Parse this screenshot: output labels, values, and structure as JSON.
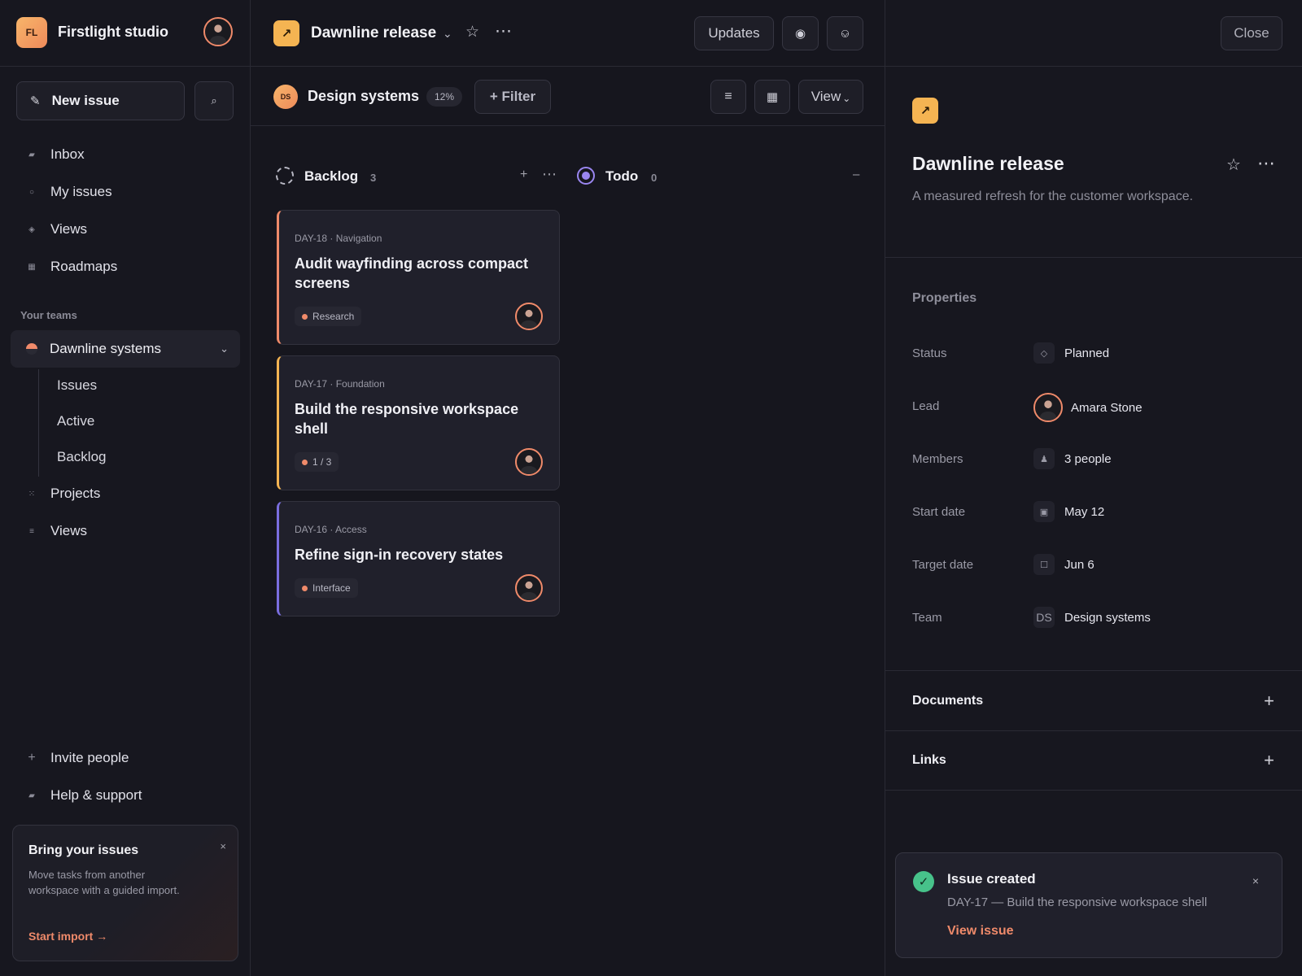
{
  "workspace": {
    "logo": "FL",
    "name": "Firstlight studio"
  },
  "sidebar": {
    "new_issue": "New issue",
    "search_icon": "⌕",
    "nav": [
      {
        "label": "Inbox",
        "icon": "▰"
      },
      {
        "label": "My issues",
        "icon": "○"
      },
      {
        "label": "Views",
        "icon": "◈"
      },
      {
        "label": "Roadmaps",
        "icon": "▦"
      }
    ],
    "teams_label": "Your teams",
    "team": {
      "name": "Dawnline systems",
      "chevron": "⌄"
    },
    "team_items": [
      "Issues",
      "Active",
      "Backlog"
    ],
    "nav2": [
      {
        "label": "Projects",
        "icon": "⁙"
      },
      {
        "label": "Views",
        "icon": "≡"
      }
    ],
    "bottom": [
      {
        "label": "Invite people",
        "icon": "+"
      },
      {
        "label": "Help & support",
        "icon": "▰"
      }
    ],
    "promo": {
      "title": "Bring your issues",
      "desc": "Move tasks from another workspace with a guided import.",
      "action": "Start import →",
      "close": "×"
    }
  },
  "header": {
    "title": "Dawnline release",
    "chevron": "⌄",
    "star": "☆",
    "more": "⋯",
    "updates": "Updates",
    "btn_record": "◉",
    "btn_share": "⎉",
    "project_icon": "↗"
  },
  "subheader": {
    "team_icon": "DS",
    "team": "Design systems",
    "progress": "12%",
    "filter": "+ Filter",
    "list_icon": "≡",
    "board_icon": "▦",
    "view": "View",
    "view_chevron": "⌄"
  },
  "board": {
    "columns": [
      {
        "title": "Backlog",
        "count": "3",
        "add": "+",
        "more": "⋯"
      },
      {
        "title": "Todo",
        "count": "0",
        "collapse": "–"
      }
    ],
    "cards": [
      {
        "meta": "DAY-18 · Navigation",
        "title": "Audit wayfinding across compact screens",
        "tag": "Research",
        "accent": "#ef8a6a"
      },
      {
        "meta": "DAY-17 · Foundation",
        "title": "Build the responsive workspace shell",
        "tag": "1 / 3",
        "accent": "#f5b452"
      },
      {
        "meta": "DAY-16 · Access",
        "title": "Refine sign-in recovery states",
        "tag": "Interface",
        "accent": "#7a6ee0"
      }
    ]
  },
  "panel": {
    "close": "Close",
    "project_icon": "↗",
    "title": "Dawnline release",
    "star": "☆",
    "more": "⋯",
    "description": "A measured refresh for the customer workspace.",
    "properties_label": "Properties",
    "properties": [
      {
        "label": "Status",
        "value": "Planned",
        "icon": "◇"
      },
      {
        "label": "Lead",
        "value": "Amara Stone",
        "icon": "avatar"
      },
      {
        "label": "Members",
        "value": "3 people",
        "icon": "♟"
      },
      {
        "label": "Start date",
        "value": "May 12",
        "icon": "▣"
      },
      {
        "label": "Target date",
        "value": "Jun 6",
        "icon": "☐"
      },
      {
        "label": "Team",
        "value": "Design systems",
        "icon": "DS"
      }
    ],
    "documents": "Documents",
    "links": "Links",
    "plus": "+"
  },
  "toast": {
    "check": "✓",
    "title": "Issue created",
    "desc": "DAY-17 — Build the responsive workspace shell",
    "action": "View issue",
    "close": "×"
  },
  "colors": {
    "accent": "#ef8a6a",
    "background": "#17171f",
    "success": "#47c28a",
    "project": "#f5b452",
    "todo": "#9a86f0"
  }
}
